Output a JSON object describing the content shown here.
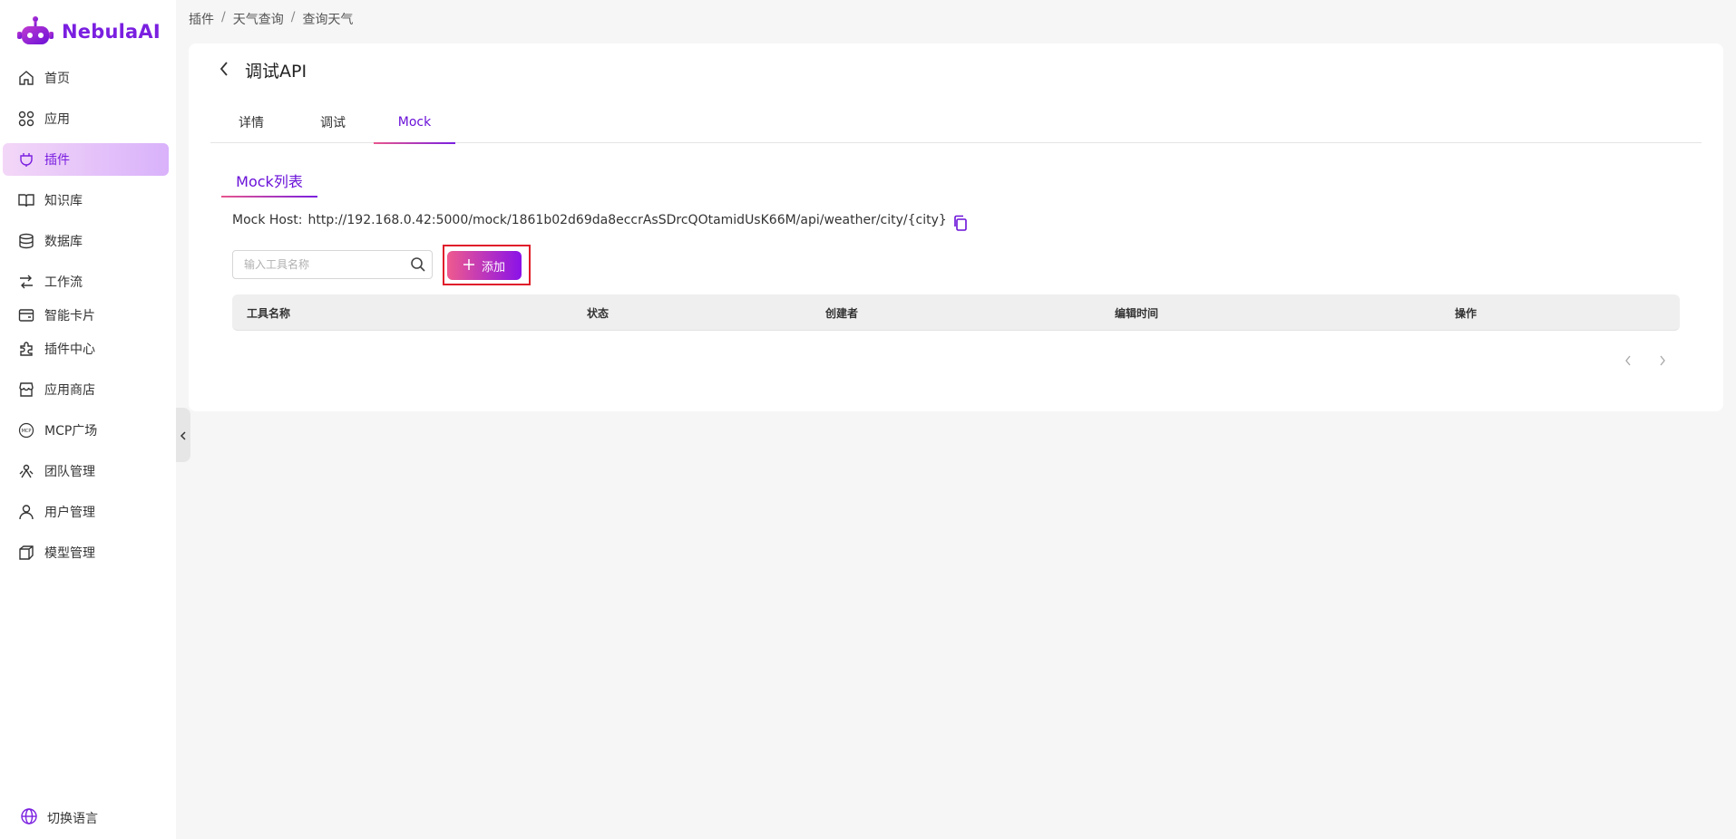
{
  "app": {
    "brand": "NebulaAI",
    "brand_color": "#7a1fe0"
  },
  "sidebar": {
    "items": [
      {
        "label": "首页",
        "icon": "home-icon",
        "active": false
      },
      {
        "label": "应用",
        "icon": "apps-grid-icon",
        "active": false
      },
      {
        "label": "插件",
        "icon": "plug-icon",
        "active": true
      },
      {
        "label": "知识库",
        "icon": "book-icon",
        "active": false
      },
      {
        "label": "数据库",
        "icon": "database-icon",
        "active": false
      },
      {
        "label": "工作流",
        "icon": "workflow-icon",
        "active": false
      },
      {
        "label": "智能卡片",
        "icon": "card-icon",
        "active": false
      },
      {
        "label": "插件中心",
        "icon": "puzzle-icon",
        "active": false
      },
      {
        "label": "应用商店",
        "icon": "store-icon",
        "active": false
      },
      {
        "label": "MCP广场",
        "icon": "mcp-icon",
        "active": false
      },
      {
        "label": "团队管理",
        "icon": "team-icon",
        "active": false
      },
      {
        "label": "用户管理",
        "icon": "user-icon",
        "active": false
      },
      {
        "label": "模型管理",
        "icon": "cube-icon",
        "active": false
      }
    ],
    "language_label": "切换语言"
  },
  "breadcrumb": [
    "插件",
    "天气查询",
    "查询天气"
  ],
  "page": {
    "title": "调试API",
    "tabs": [
      {
        "label": "详情",
        "active": false
      },
      {
        "label": "调试",
        "active": false
      },
      {
        "label": "Mock",
        "active": true
      }
    ],
    "subtab": "Mock列表",
    "mock_host_label": "Mock Host:",
    "mock_host_url": "http://192.168.0.42:5000/mock/1861b02d69da8eccrAsSDrcQOtamidUsK66M/api/weather/city/{city}",
    "search": {
      "placeholder": "输入工具名称",
      "value": ""
    },
    "add_button": "添加",
    "table": {
      "columns": [
        "工具名称",
        "状态",
        "创建者",
        "编辑时间",
        "操作"
      ],
      "rows": []
    }
  }
}
